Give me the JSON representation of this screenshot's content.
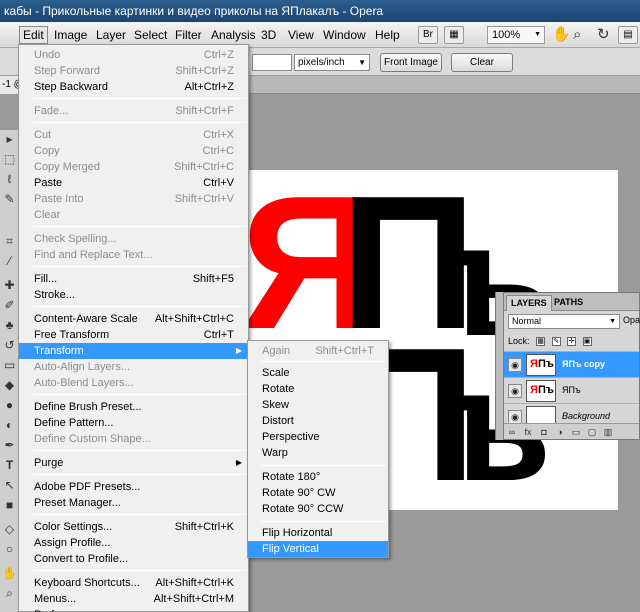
{
  "window": {
    "title": "кабы - Прикольные картинки и видео приколы на ЯПлакалъ - Opera"
  },
  "menubar": {
    "items": [
      "Edit",
      "Image",
      "Layer",
      "Select",
      "Filter",
      "Analysis",
      "3D",
      "View",
      "Window",
      "Help"
    ],
    "active": "Edit",
    "br_label": "Br",
    "zoom": "100%"
  },
  "options_bar": {
    "unit_select": "pixels/inch",
    "front_image_button": "Front Image",
    "clear_button": "Clear"
  },
  "doc_tab": {
    "label": "-1 @"
  },
  "edit_menu": {
    "rows": [
      {
        "label": "Undo",
        "shortcut": "Ctrl+Z",
        "disabled": true
      },
      {
        "label": "Step Forward",
        "shortcut": "Shift+Ctrl+Z",
        "disabled": true
      },
      {
        "label": "Step Backward",
        "shortcut": "Alt+Ctrl+Z",
        "disabled": false
      },
      {
        "label": "Fade...",
        "shortcut": "Shift+Ctrl+F",
        "disabled": true
      },
      {
        "label": "Cut",
        "shortcut": "Ctrl+X",
        "disabled": true
      },
      {
        "label": "Copy",
        "shortcut": "Ctrl+C",
        "disabled": true
      },
      {
        "label": "Copy Merged",
        "shortcut": "Shift+Ctrl+C",
        "disabled": true
      },
      {
        "label": "Paste",
        "shortcut": "Ctrl+V",
        "disabled": false
      },
      {
        "label": "Paste Into",
        "shortcut": "Shift+Ctrl+V",
        "disabled": true
      },
      {
        "label": "Clear",
        "shortcut": "",
        "disabled": true
      },
      {
        "label": "Check Spelling...",
        "shortcut": "",
        "disabled": true
      },
      {
        "label": "Find and Replace Text...",
        "shortcut": "",
        "disabled": true
      },
      {
        "label": "Fill...",
        "shortcut": "Shift+F5",
        "disabled": false
      },
      {
        "label": "Stroke...",
        "shortcut": "",
        "disabled": false
      },
      {
        "label": "Content-Aware Scale",
        "shortcut": "Alt+Shift+Ctrl+C",
        "disabled": false
      },
      {
        "label": "Free Transform",
        "shortcut": "Ctrl+T",
        "disabled": false
      },
      {
        "label": "Transform",
        "shortcut": "",
        "disabled": false
      },
      {
        "label": "Auto-Align Layers...",
        "shortcut": "",
        "disabled": true
      },
      {
        "label": "Auto-Blend Layers...",
        "shortcut": "",
        "disabled": true
      },
      {
        "label": "Define Brush Preset...",
        "shortcut": "",
        "disabled": false
      },
      {
        "label": "Define Pattern...",
        "shortcut": "",
        "disabled": false
      },
      {
        "label": "Define Custom Shape...",
        "shortcut": "",
        "disabled": true
      },
      {
        "label": "Purge",
        "shortcut": "",
        "disabled": false
      },
      {
        "label": "Adobe PDF Presets...",
        "shortcut": "",
        "disabled": false
      },
      {
        "label": "Preset Manager...",
        "shortcut": "",
        "disabled": false
      },
      {
        "label": "Color Settings...",
        "shortcut": "Shift+Ctrl+K",
        "disabled": false
      },
      {
        "label": "Assign Profile...",
        "shortcut": "",
        "disabled": false
      },
      {
        "label": "Convert to Profile...",
        "shortcut": "",
        "disabled": false
      },
      {
        "label": "Keyboard Shortcuts...",
        "shortcut": "Alt+Shift+Ctrl+K",
        "disabled": false
      },
      {
        "label": "Menus...",
        "shortcut": "Alt+Shift+Ctrl+M",
        "disabled": false
      },
      {
        "label": "Preferences",
        "shortcut": "",
        "disabled": false
      }
    ]
  },
  "transform_submenu": {
    "rows": [
      {
        "label": "Again",
        "shortcut": "Shift+Ctrl+T",
        "disabled": true
      },
      {
        "label": "Scale",
        "shortcut": "",
        "disabled": false
      },
      {
        "label": "Rotate",
        "shortcut": "",
        "disabled": false
      },
      {
        "label": "Skew",
        "shortcut": "",
        "disabled": false
      },
      {
        "label": "Distort",
        "shortcut": "",
        "disabled": false
      },
      {
        "label": "Perspective",
        "shortcut": "",
        "disabled": false
      },
      {
        "label": "Warp",
        "shortcut": "",
        "disabled": false
      },
      {
        "label": "Rotate 180°",
        "shortcut": "",
        "disabled": false
      },
      {
        "label": "Rotate 90° CW",
        "shortcut": "",
        "disabled": false
      },
      {
        "label": "Rotate 90° CCW",
        "shortcut": "",
        "disabled": false
      },
      {
        "label": "Flip Horizontal",
        "shortcut": "",
        "disabled": false
      },
      {
        "label": "Flip Vertical",
        "shortcut": "",
        "disabled": false
      }
    ],
    "highlighted": "Flip Vertical"
  },
  "canvas_art": {
    "glyph_red": "Я",
    "glyph_black_p": "П",
    "glyph_black_hard": "ъ",
    "red_color": "#ff0000",
    "black_color": "#000000"
  },
  "layers_panel": {
    "tabs": [
      "LAYERS",
      "PATHS"
    ],
    "blend_mode": "Normal",
    "opacity_label": "Opac",
    "lock_label": "Lock:",
    "layers": [
      {
        "name": "ЯПъ copy",
        "selected": true,
        "italic": false
      },
      {
        "name": "ЯПъ",
        "selected": false,
        "italic": false
      },
      {
        "name": "Background",
        "selected": false,
        "italic": true
      }
    ]
  }
}
